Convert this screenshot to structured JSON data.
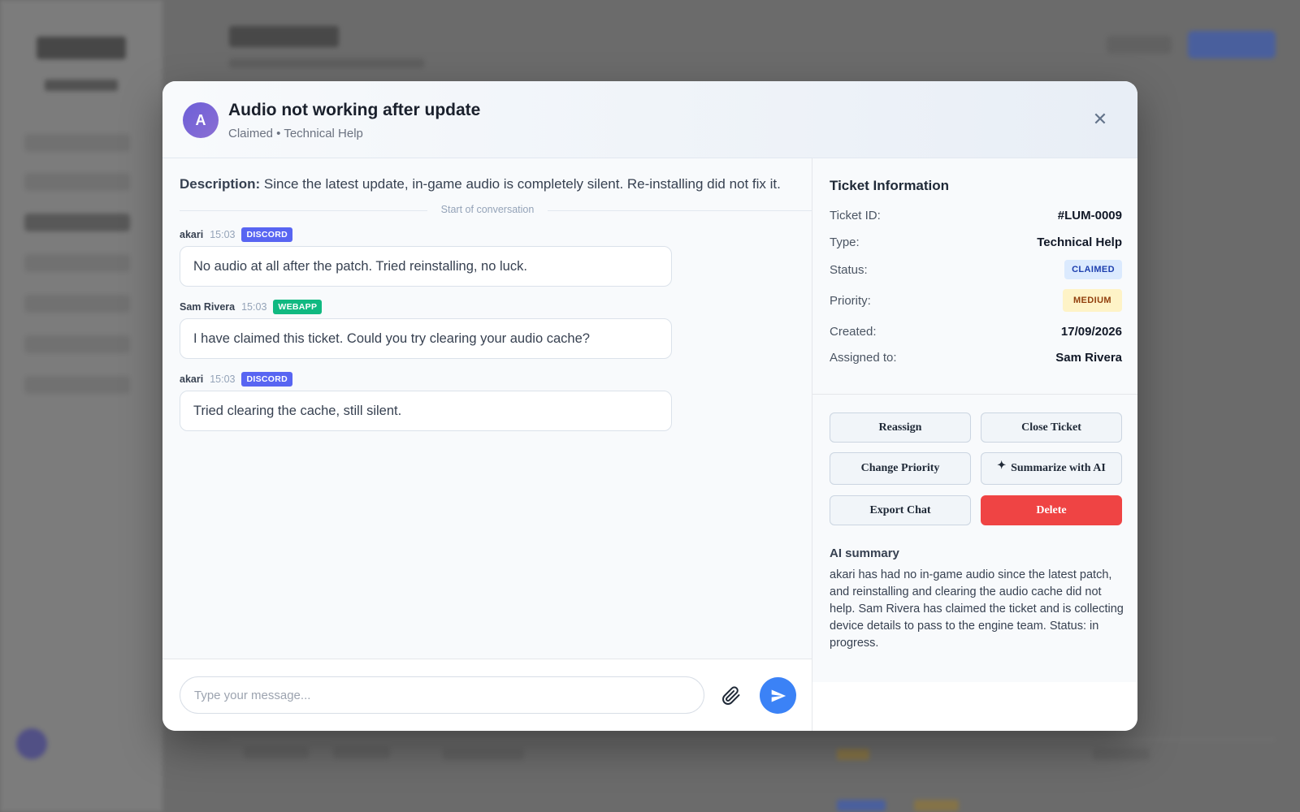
{
  "ticket": {
    "avatar_letter": "A",
    "title": "Audio not working after update",
    "subtitle": "Claimed • Technical Help",
    "description_label": "Description:",
    "description_text": "Since the latest update, in-game audio is completely silent. Re-installing did not fix it."
  },
  "conversation": {
    "start_label": "Start of conversation",
    "messages": [
      {
        "author": "akari",
        "time": "15:03",
        "source": "DISCORD",
        "text": "No audio at all after the patch. Tried reinstalling, no luck."
      },
      {
        "author": "Sam Rivera",
        "time": "15:03",
        "source": "WEBAPP",
        "text": "I have claimed this ticket. Could you try clearing your audio cache?"
      },
      {
        "author": "akari",
        "time": "15:03",
        "source": "DISCORD",
        "text": "Tried clearing the cache, still silent."
      }
    ]
  },
  "composer": {
    "placeholder": "Type your message..."
  },
  "info": {
    "title": "Ticket Information",
    "ticket_id_label": "Ticket ID:",
    "ticket_id": "#LUM-0009",
    "type_label": "Type:",
    "type": "Technical Help",
    "status_label": "Status:",
    "status": "CLAIMED",
    "priority_label": "Priority:",
    "priority": "MEDIUM",
    "created_label": "Created:",
    "created": "17/09/2026",
    "assigned_label": "Assigned to:",
    "assigned": "Sam Rivera"
  },
  "actions": {
    "reassign": "Reassign",
    "close_ticket": "Close Ticket",
    "change_priority": "Change Priority",
    "summarize": "Summarize with AI",
    "export_chat": "Export Chat",
    "delete": "Delete"
  },
  "ai_summary": {
    "title": "AI summary",
    "text": "akari has had no in-game audio since the latest patch, and reinstalling and clearing the audio cache did not help. Sam Rivera has claimed the ticket and is collecting device details to pass to the engine team. Status: in progress."
  },
  "colors": {
    "discord": "#5865f2",
    "webapp": "#10b981",
    "accent": "#3b82f6",
    "danger": "#ef4444"
  }
}
